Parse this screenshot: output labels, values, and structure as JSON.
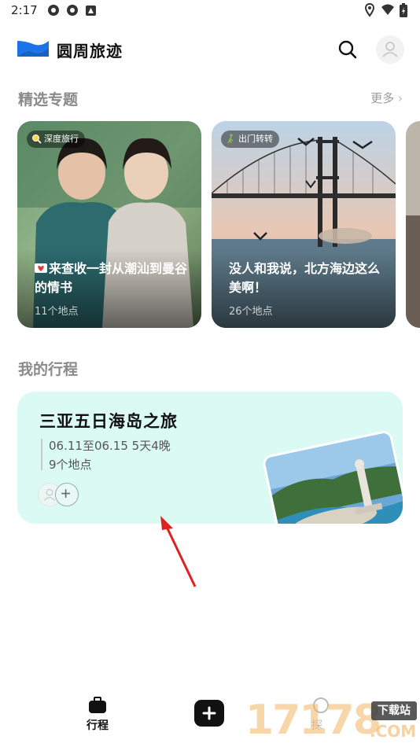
{
  "status": {
    "time": "2:17"
  },
  "app": {
    "title": "圆周旅迹"
  },
  "featured": {
    "title": "精选专题",
    "more": "更多",
    "cards": [
      {
        "tag": "深度旅行",
        "title": "来查收一封从潮汕到曼谷的情书",
        "count": "11个地点"
      },
      {
        "tag": "出门转转",
        "title": "没人和我说，北方海边这么美啊！",
        "count": "26个地点"
      }
    ]
  },
  "my_trips": {
    "title": "我的行程",
    "trip": {
      "name": "三亚五日海岛之旅",
      "dates": "06.11至06.15 5天4晚",
      "places": "9个地点"
    }
  },
  "nav": {
    "trip_label": "行程",
    "explore_label": "探"
  },
  "watermark": {
    "number": "17178",
    "brand": "下载站",
    "domain": ".COM"
  },
  "colors": {
    "accent": "#1a73e8",
    "trip_card_bg": "#dcfaf4"
  }
}
